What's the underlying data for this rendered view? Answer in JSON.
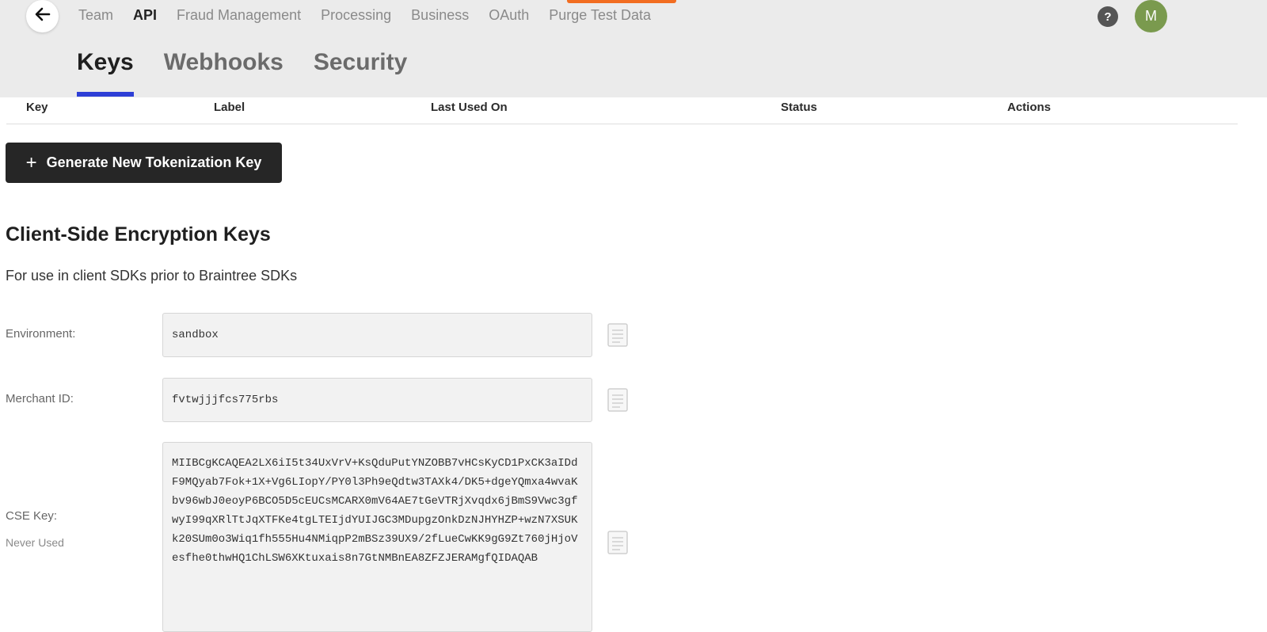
{
  "header": {
    "back_icon": "arrow-left-icon",
    "nav": [
      {
        "label": "Team"
      },
      {
        "label": "API",
        "active": true
      },
      {
        "label": "Fraud Management"
      },
      {
        "label": "Processing"
      },
      {
        "label": "Business"
      },
      {
        "label": "OAuth"
      },
      {
        "label": "Purge Test Data"
      }
    ],
    "help_label": "?",
    "avatar_initial": "M",
    "accent_color": "#f26d21"
  },
  "subtabs": [
    {
      "label": "Keys",
      "active": true
    },
    {
      "label": "Webhooks"
    },
    {
      "label": "Security"
    }
  ],
  "table": {
    "columns": [
      "Key",
      "Label",
      "Last Used On",
      "Status",
      "Actions"
    ]
  },
  "generate_button": {
    "icon": "plus-icon",
    "label": "Generate New Tokenization Key"
  },
  "cse": {
    "title": "Client-Side Encryption Keys",
    "description": "For use in client SDKs prior to Braintree SDKs",
    "environment": {
      "label": "Environment:",
      "value": "sandbox"
    },
    "merchant_id": {
      "label": "Merchant ID:",
      "value": "fvtwjjjfcs775rbs"
    },
    "cse_key": {
      "label": "CSE Key:",
      "sublabel": "Never Used",
      "value": "MIIBCgKCAQEA2LX6iI5t34UxVrV+KsQduPutYNZOBB7vHCsKyCD1PxCK3aIDdF9MQyab7Fok+1X+Vg6LIopY/PY0l3Ph9eQdtw3TAXk4/DK5+dgeYQmxa4wvaKbv96wbJ0eoyP6BCO5D5cEUCsMCARX0mV64AE7tGeVTRjXvqdx6jBmS9Vwc3gfwyI99qXRlTtJqXTFKe4tgLTEIjdYUIJGC3MDupgzOnkDzNJHYHZP+wzN7XSUKk20SUm0o3Wiq1fh555Hu4NMiqpP2mBSz39UX9/2fLueCwKK9gG9Zt760jHjoVesfhe0thwHQ1ChLSW6XKtuxais8n7GtNMBnEA8ZFZJERAMgfQIDAQAB"
    }
  }
}
